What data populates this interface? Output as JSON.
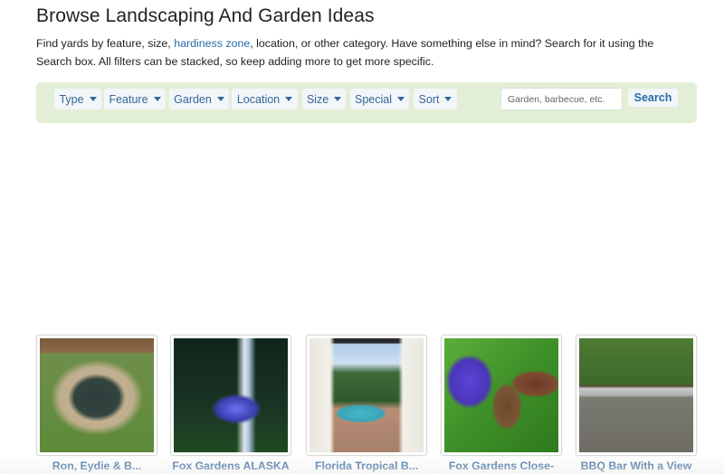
{
  "page": {
    "title": "Browse Landscaping And Garden Ideas",
    "intro": {
      "before_link": "Find yards by feature, size, ",
      "link_text": "hardiness zone",
      "after_link": ", location, or other category. Have something else in mind? Search for it using the Search box. All filters can be stacked, so keep adding more to get more specific."
    }
  },
  "filters": [
    {
      "label": "Type",
      "icon": "caret-down-icon"
    },
    {
      "label": "Feature",
      "icon": "caret-down-icon"
    },
    {
      "label": "Garden",
      "icon": "caret-down-icon"
    },
    {
      "label": "Location",
      "icon": "caret-down-icon"
    },
    {
      "label": "Size",
      "icon": "caret-down-icon"
    },
    {
      "label": "Special",
      "icon": "caret-down-icon"
    },
    {
      "label": "Sort",
      "icon": "caret-down-icon"
    }
  ],
  "search": {
    "placeholder": "Garden, barbecue, etc.",
    "value": "",
    "button_label": "Search"
  },
  "colors": {
    "filter_bar_bg": "#e2efd6",
    "link": "#2a6ca8",
    "button_text": "#336699"
  },
  "gallery": [
    {
      "caption": "Ron, Eydie & B...",
      "image": "garden-pond-photo"
    },
    {
      "caption": "Fox Gardens ALASKA",
      "image": "river-forest-photo"
    },
    {
      "caption": "Florida Tropical B...",
      "image": "pool-patio-curtains-photo"
    },
    {
      "caption": "Fox Gardens Close-",
      "image": "hummingbird-moth-flower-photo"
    },
    {
      "caption": "BBQ Bar With a View",
      "image": "outdoor-bbq-bar-photo"
    }
  ]
}
